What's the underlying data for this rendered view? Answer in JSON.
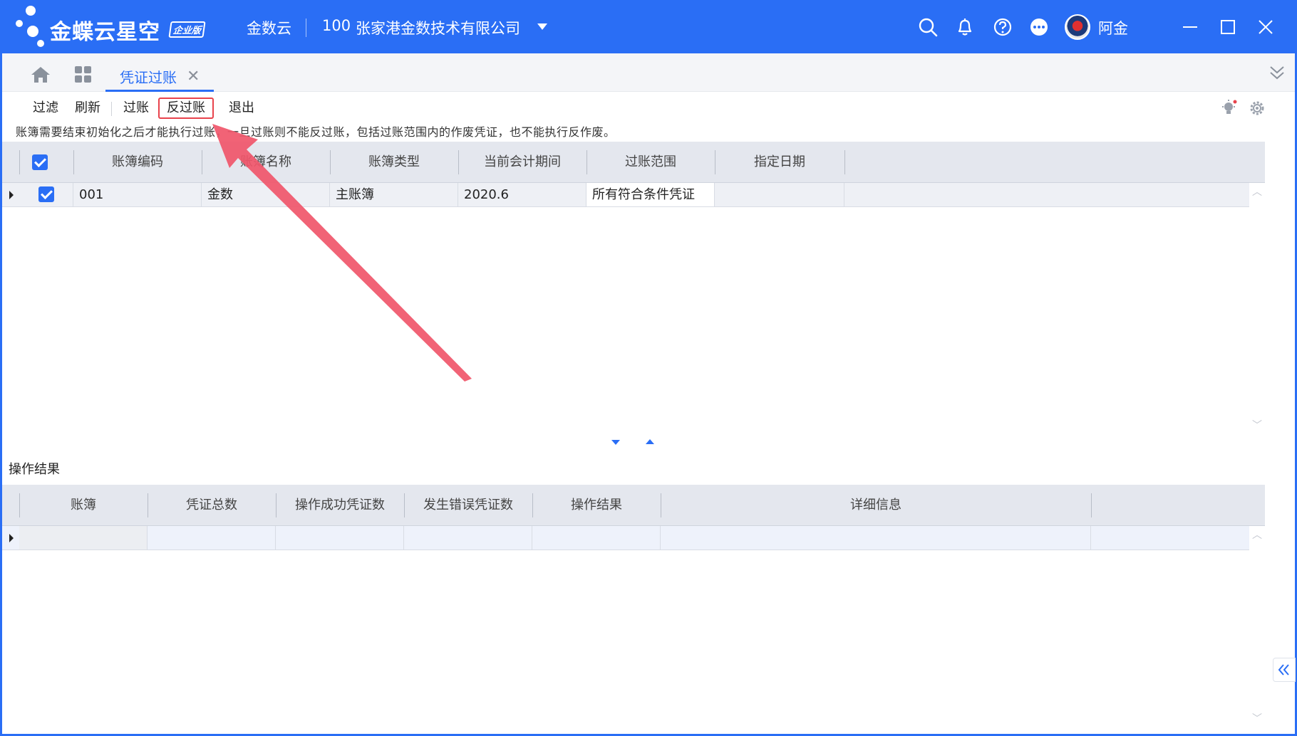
{
  "titlebar": {
    "brand": "金蝶云星空",
    "edition_badge": "企业版",
    "product": "金数云",
    "org_code": "100",
    "org_name": "张家港金数技术有限公司",
    "user_name": "阿金",
    "icons": [
      "search-icon",
      "bell-icon",
      "help-icon",
      "more-icon"
    ]
  },
  "tabbar": {
    "active_tab": "凭证过账",
    "close_glyph": "✕"
  },
  "toolbar": {
    "filter": "过滤",
    "refresh": "刷新",
    "post": "过账",
    "unpost": "反过账",
    "exit": "退出"
  },
  "notice": "账簿需要结束初始化之后才能执行过账，一旦过账则不能反过账，包括过账范围内的作废凭证，也不能执行反作废。",
  "ledger_grid": {
    "header_checked": true,
    "columns": [
      "账簿编码",
      "账簿名称",
      "账簿类型",
      "当前会计期间",
      "过账范围",
      "指定日期"
    ],
    "rows": [
      {
        "checked": true,
        "code": "001",
        "name": "金数",
        "type": "主账簿",
        "period": "2020.6",
        "scope": "所有符合条件凭证",
        "date": ""
      }
    ]
  },
  "result_section": {
    "title": "操作结果",
    "columns": [
      "账簿",
      "凭证总数",
      "操作成功凭证数",
      "发生错误凭证数",
      "操作结果",
      "详细信息"
    ]
  },
  "colors": {
    "primary": "#2a6ef5",
    "highlight_border": "#e8434c",
    "annotation_arrow": "#f0566a"
  }
}
